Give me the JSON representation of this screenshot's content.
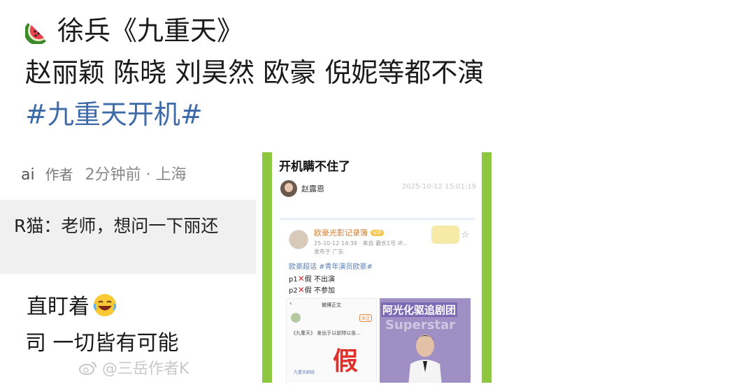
{
  "post": {
    "line1": "徐兵《九重天》",
    "line2": "赵丽颖 陈晓 刘昊然 欧豪 倪妮等都不演",
    "hashtag": "#九重天开机#"
  },
  "left_screenshot": {
    "user_fragment": "ai",
    "author_tag": "作者",
    "time": "2分钟前 · 上海",
    "comment": "R猫：老师，想问一下丽还",
    "reply_line1": "直盯着",
    "reply_line2": "司 一切皆有可能",
    "watermark": "@三岳作者K"
  },
  "center_screenshot": {
    "title": "开机瞒不住了",
    "author": "赵露恩",
    "date": "2025-10-12 15:01:19",
    "inner_post": {
      "account": "欧豪光影记录簿",
      "badge": "VIP",
      "time": "25-10-12 14:38 · 来自 霸长1号 iP...",
      "location": "发布于 广东",
      "tags": "欧豪超话  #青年演员欧豪#",
      "p1_prefix": "p1",
      "p1_text": "假 不出演",
      "p2_prefix": "p2",
      "p2_text": "假 不参加",
      "mini_left": {
        "header": "微博正文",
        "follow": "关注",
        "body": "《九重天》 发出于以前特以告...",
        "fake": "假",
        "sub": "九重天剧组"
      },
      "mini_right": {
        "banner": "阿光化驱追剧团",
        "overlay": "Superstar"
      }
    }
  },
  "icons": [
    "watermelon-icon",
    "laugh-emoji-icon",
    "weibo-icon",
    "star-icon",
    "back-arrow-icon",
    "x-mark-icon"
  ],
  "colors": {
    "hashtag": "#3d6aa8",
    "frame_green": "#8dc63f",
    "x_red": "#d0312d"
  }
}
